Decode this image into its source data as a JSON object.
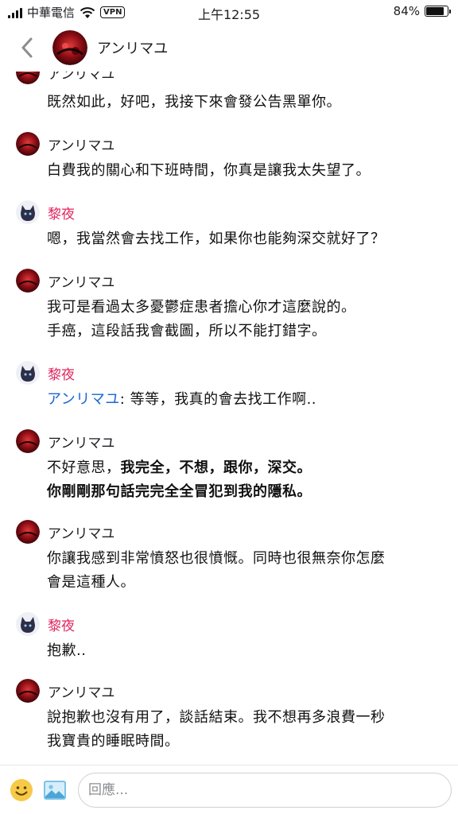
{
  "status_bar": {
    "carrier": "中華電信",
    "vpn": "VPN",
    "time": "上午12:55",
    "battery_percent": "84%",
    "battery_level": 0.84
  },
  "header": {
    "back_icon": "chevron-left-icon",
    "title": "アンリマユ"
  },
  "messages": [
    {
      "author": "アンリマユ",
      "lines": [
        "既然如此，好吧，我接下來會發公告黑單你。"
      ]
    },
    {
      "author": "アンリマユ",
      "lines": [
        "白費我的關心和下班時間，你真是讓我太失望了。"
      ]
    },
    {
      "author": "黎夜",
      "lines": [
        "嗯，我當然會去找工作，如果你也能夠深交就好了？"
      ]
    },
    {
      "author": "アンリマユ",
      "lines": [
        "我可是看過太多憂鬱症患者擔心你才這麼說的。",
        "手癌，這段話我會截圖，所以不能打錯字。"
      ]
    },
    {
      "author": "黎夜",
      "mention": "アンリマユ",
      "text_after_mention": ": 等等，我真的會去找工作啊.."
    },
    {
      "author": "アンリマユ",
      "line1_plain": "不好意思，",
      "line1_bold": "我完全，不想，跟你，深交。",
      "line2_bold": "你剛剛那句話完完全全冒犯到我的隱私。"
    },
    {
      "author": "アンリマユ",
      "lines": [
        "你讓我感到非常憤怒也很憤慨。同時也很無奈你怎麼",
        "會是這種人。"
      ]
    },
    {
      "author": "黎夜",
      "lines": [
        "抱歉.."
      ]
    },
    {
      "author": "アンリマユ",
      "lines": [
        "說抱歉也沒有用了，談話結束。我不想再多浪費一秒",
        "我寶貴的睡眠時間。"
      ]
    }
  ],
  "composer": {
    "placeholder": "回應...",
    "emoji_icon": "smiley-icon",
    "photo_icon": "photo-icon"
  },
  "colors": {
    "accent_name": "#e0245e",
    "mention": "#1a66d6",
    "text": "#111111"
  }
}
